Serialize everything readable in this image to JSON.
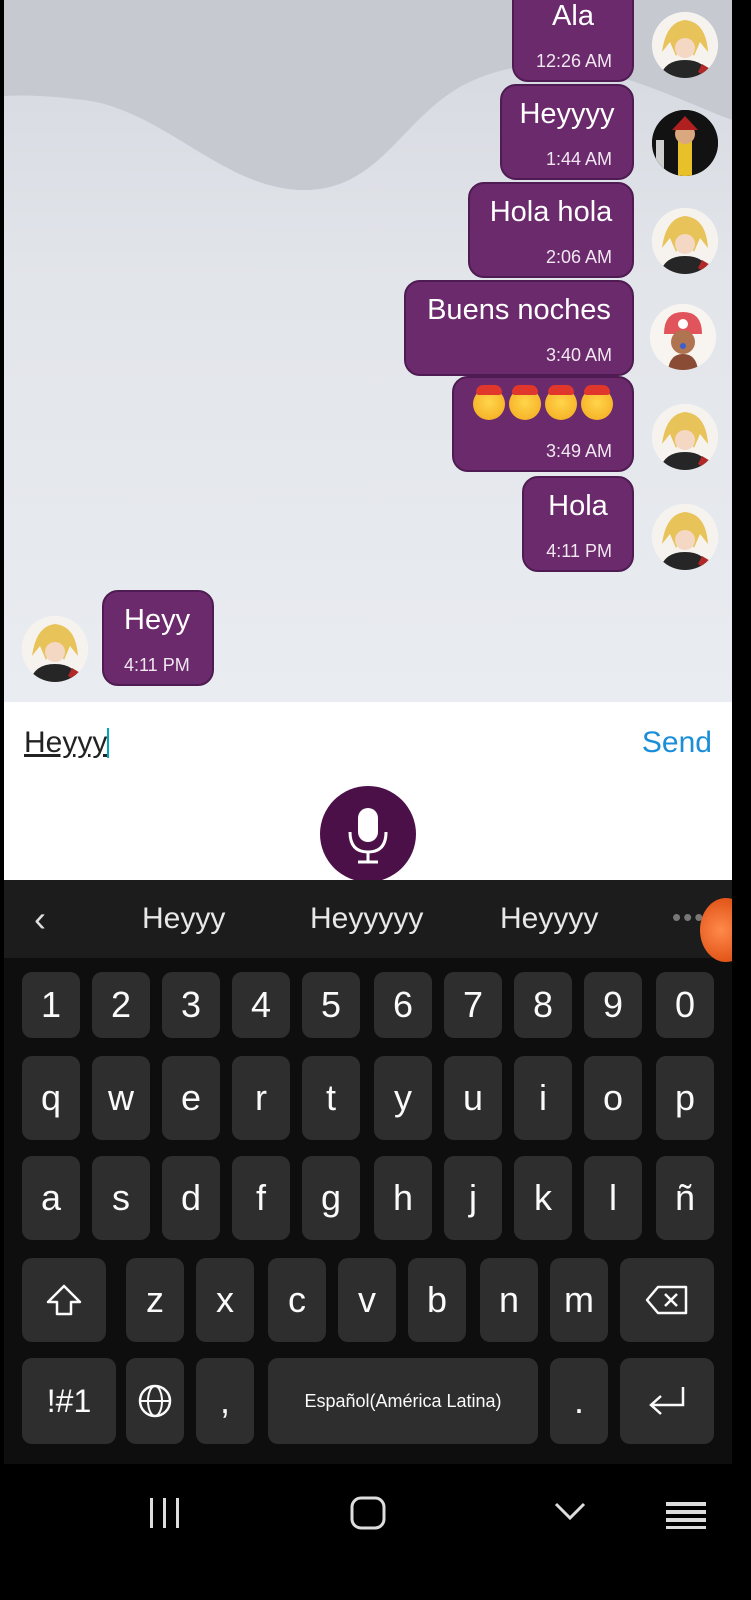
{
  "chat": {
    "messages": [
      {
        "text": "Ala",
        "time": "12:26 AM"
      },
      {
        "text": "Heyyyy",
        "time": "1:44 AM"
      },
      {
        "text": "Hola hola",
        "time": "2:06 AM"
      },
      {
        "text": "Buens noches",
        "time": "3:40 AM"
      },
      {
        "text": "",
        "emoji_count": 4,
        "time": "3:49 AM"
      },
      {
        "text": "Hola",
        "time": "4:11 PM"
      },
      {
        "text": "Heyy",
        "time": "4:11 PM"
      }
    ]
  },
  "composer": {
    "input_value": "Heyyy",
    "send_label": "Send"
  },
  "keyboard": {
    "suggestions": [
      "Heyyy",
      "Heyyyyy",
      "Heyyyy"
    ],
    "number_row": [
      "1",
      "2",
      "3",
      "4",
      "5",
      "6",
      "7",
      "8",
      "9",
      "0"
    ],
    "row1": [
      "q",
      "w",
      "e",
      "r",
      "t",
      "y",
      "u",
      "i",
      "o",
      "p"
    ],
    "row2": [
      "a",
      "s",
      "d",
      "f",
      "g",
      "h",
      "j",
      "k",
      "l",
      "ñ"
    ],
    "row3": [
      "z",
      "x",
      "c",
      "v",
      "b",
      "n",
      "m"
    ],
    "symbols_label": "!#1",
    "comma": ",",
    "space_label": "Español(América Latina)",
    "period": "."
  },
  "colors": {
    "bubble": "#6b2a6c",
    "send": "#1a8ed8",
    "mic": "#4b1048",
    "keyboard_bg": "#0e0e0e",
    "key_bg": "#2e2e2e"
  }
}
